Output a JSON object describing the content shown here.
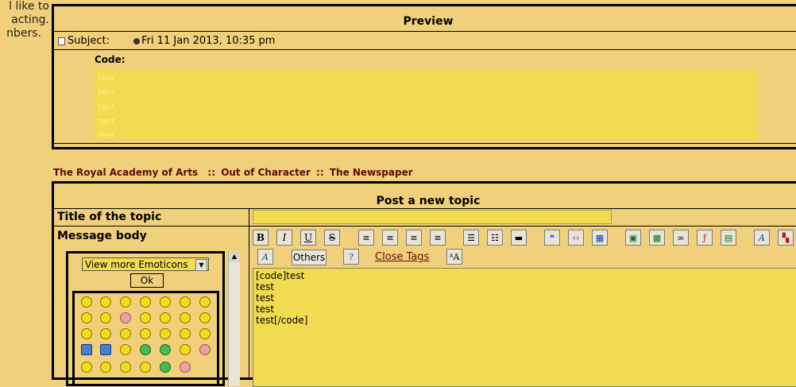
{
  "left_text": {
    "line1": "l like to",
    "line2": "acting.",
    "line3": "nbers."
  },
  "preview": {
    "title": "Preview",
    "subject_label": "Subject:",
    "date": "Fri 11 Jan 2013, 10:35 pm",
    "code_label": "Code:",
    "code_lines": [
      "test",
      "test",
      "test",
      "test",
      "test"
    ]
  },
  "breadcrumb": {
    "item1": "The Royal Academy of Arts",
    "item2": "Out of Character",
    "item3": "The Newspaper",
    "separator": "::"
  },
  "form": {
    "header": "Post a new topic",
    "title_label": "Title of the topic",
    "message_label": "Message body",
    "title_value": "",
    "emoticons": {
      "select_value": "View more Emoticons",
      "ok_label": "Ok"
    },
    "toolbar": {
      "bold": "B",
      "italic": "I",
      "underline": "U",
      "strike": "S",
      "others_label": "Others",
      "close_tags_label": "Close Tags",
      "font_size": "A",
      "font_color": "A"
    },
    "message_value": "[code]test\ntest\ntest\ntest\ntest[/code]"
  }
}
